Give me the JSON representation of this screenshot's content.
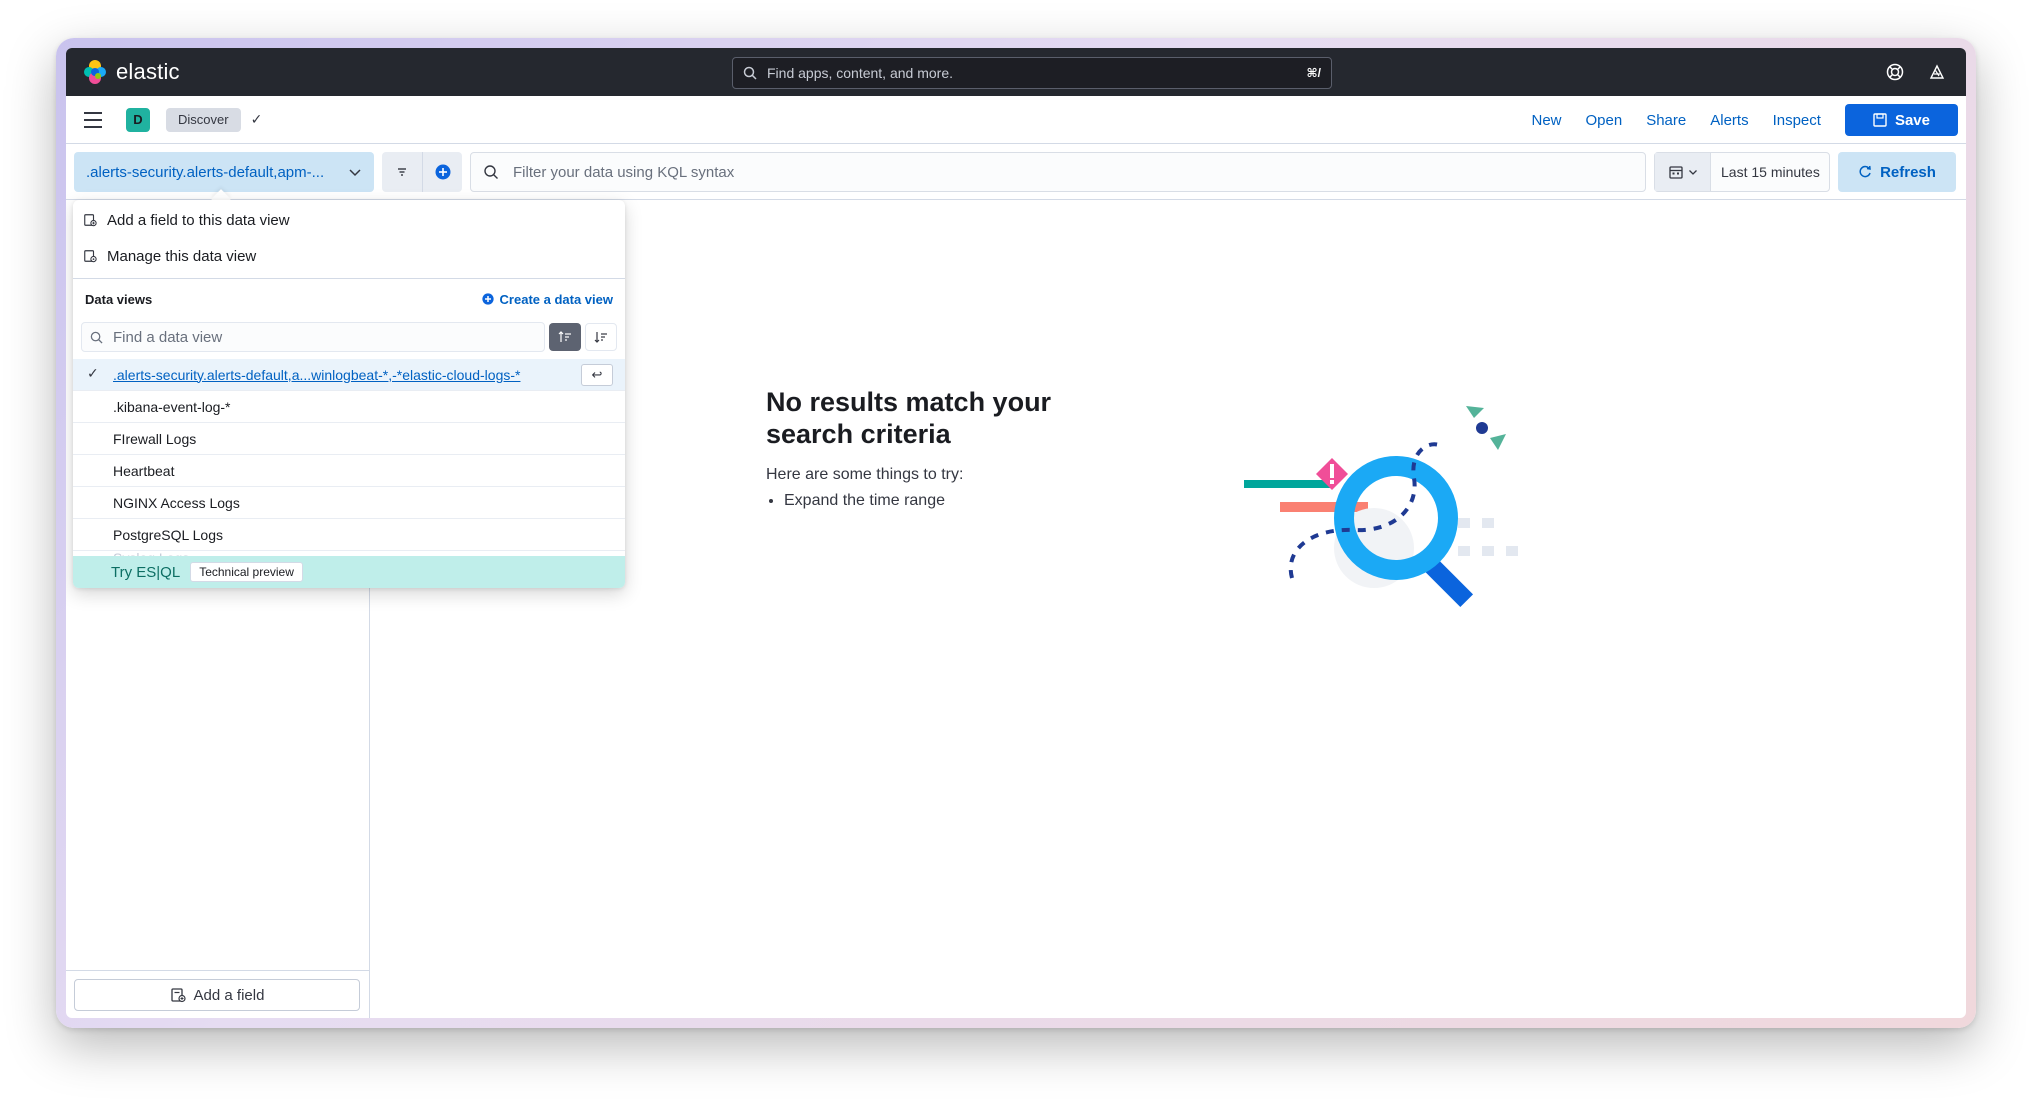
{
  "header": {
    "brand": "elastic",
    "search_placeholder": "Find apps, content, and more.",
    "search_shortcut": "⌘/"
  },
  "appbar": {
    "space_initial": "D",
    "breadcrumb": "Discover",
    "links": {
      "new": "New",
      "open": "Open",
      "share": "Share",
      "alerts": "Alerts",
      "inspect": "Inspect"
    },
    "save": "Save"
  },
  "querybar": {
    "data_view": ".alerts-security.alerts-default,apm-...",
    "kql_placeholder": "Filter your data using KQL syntax",
    "time_range": "Last 15 minutes",
    "refresh": "Refresh"
  },
  "popover": {
    "add_field": "Add a field to this data view",
    "manage": "Manage this data view",
    "data_views_title": "Data views",
    "create_data_view": "Create a data view",
    "find_placeholder": "Find a data view",
    "selected": ".alerts-security.alerts-default,a...winlogbeat-*,-*elastic-cloud-logs-*",
    "items": [
      ".kibana-event-log-*",
      "FIrewall Logs",
      "Heartbeat",
      "NGINX Access Logs",
      "PostgreSQL Logs",
      "Syslog Logs"
    ],
    "esql_label": "Try ES|QL",
    "esql_badge": "Technical preview"
  },
  "sidebar": {
    "add_field": "Add a field"
  },
  "empty_state": {
    "title": "No results match your search criteria",
    "subtitle": "Here are some things to try:",
    "tips": [
      "Expand the time range"
    ]
  },
  "colors": {
    "accent": "#0b64dd",
    "link": "#0061c2",
    "header_bg": "#25282f",
    "esql_bg": "#bfeeea"
  }
}
